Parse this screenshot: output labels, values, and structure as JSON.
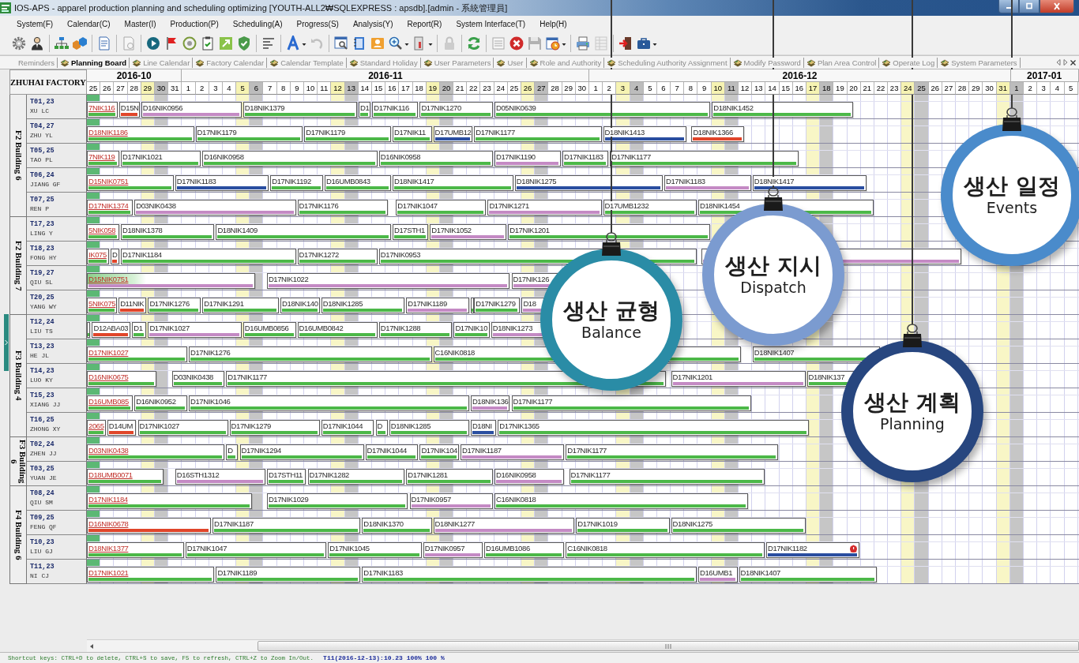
{
  "window": {
    "title": "IOS-APS - apparel production planning and scheduling optimizing [YOUTH-ALL2₩SQLEXPRESS : apsdb].[admin - 系統管理員]"
  },
  "menu": [
    "System(F)",
    "Calendar(C)",
    "Master(I)",
    "Production(P)",
    "Scheduling(A)",
    "Progress(S)",
    "Analysis(Y)",
    "Report(R)",
    "System Interface(T)",
    "Help(H)"
  ],
  "toolbar": [
    {
      "items": [
        {
          "disabled": false,
          "menu": false
        },
        {
          "disabled": false,
          "menu": false
        }
      ]
    },
    {
      "items": [
        {
          "disabled": false,
          "menu": false
        },
        {
          "disabled": false,
          "menu": false
        }
      ]
    },
    {
      "items": [
        {
          "disabled": false,
          "menu": false
        }
      ]
    },
    {
      "items": [
        {
          "disabled": true,
          "menu": false
        }
      ]
    },
    {
      "items": [
        {
          "disabled": false,
          "menu": false
        },
        {
          "disabled": false,
          "menu": false
        },
        {
          "disabled": false,
          "menu": false
        },
        {
          "disabled": false,
          "menu": false
        },
        {
          "disabled": false,
          "menu": false
        },
        {
          "disabled": false,
          "menu": false
        }
      ]
    },
    {
      "items": [
        {
          "disabled": false,
          "menu": false
        }
      ]
    },
    {
      "items": [
        {
          "disabled": false,
          "menu": true
        },
        {
          "disabled": true,
          "menu": false
        }
      ]
    },
    {
      "items": [
        {
          "disabled": false,
          "menu": false
        },
        {
          "disabled": false,
          "menu": false
        },
        {
          "disabled": false,
          "menu": false
        },
        {
          "disabled": false,
          "menu": true
        },
        {
          "disabled": false,
          "menu": true
        }
      ]
    },
    {
      "items": [
        {
          "disabled": true,
          "menu": false
        }
      ]
    },
    {
      "items": [
        {
          "disabled": false,
          "menu": false
        }
      ]
    },
    {
      "items": [
        {
          "disabled": true,
          "menu": false
        },
        {
          "disabled": false,
          "menu": false
        },
        {
          "disabled": true,
          "menu": false
        },
        {
          "disabled": false,
          "menu": true
        }
      ]
    },
    {
      "items": [
        {
          "disabled": false,
          "menu": false
        },
        {
          "disabled": true,
          "menu": false
        }
      ]
    },
    {
      "items": [
        {
          "disabled": false,
          "menu": false
        },
        {
          "disabled": false,
          "menu": true
        }
      ]
    }
  ],
  "tabs": [
    {
      "label": "Reminders",
      "selected": false,
      "kind": "plain"
    },
    {
      "label": "Planning Board",
      "selected": true,
      "kind": "module"
    },
    {
      "label": "Line Calendar",
      "selected": false,
      "kind": "module"
    },
    {
      "label": "Factory Calendar",
      "selected": false,
      "kind": "module"
    },
    {
      "label": "Calendar Template",
      "selected": false,
      "kind": "module"
    },
    {
      "label": "Standard Holiday",
      "selected": false,
      "kind": "module"
    },
    {
      "label": "User Parameters",
      "selected": false,
      "kind": "module"
    },
    {
      "label": "User",
      "selected": false,
      "kind": "module"
    },
    {
      "label": "Role and Authority",
      "selected": false,
      "kind": "module"
    },
    {
      "label": "Scheduling Authority Assignment",
      "selected": false,
      "kind": "module"
    },
    {
      "label": "Modify Password",
      "selected": false,
      "kind": "module"
    },
    {
      "label": "Plan Area Control",
      "selected": false,
      "kind": "module"
    },
    {
      "label": "Operate Log",
      "selected": false,
      "kind": "module"
    },
    {
      "label": "System Parameters",
      "selected": false,
      "kind": "module"
    }
  ],
  "board": {
    "corner": "ZHUHAI FACTORY",
    "months": [
      {
        "label": "2016-10",
        "days": [
          {
            "label": "25",
            "kind": "workday"
          },
          {
            "label": "26",
            "kind": "workday"
          },
          {
            "label": "27",
            "kind": "workday"
          },
          {
            "label": "28",
            "kind": "workday"
          },
          {
            "label": "29",
            "kind": "saturday"
          },
          {
            "label": "30",
            "kind": "sunday"
          },
          {
            "label": "31",
            "kind": "workday"
          }
        ]
      },
      {
        "label": "2016-11",
        "days": [
          {
            "label": "1",
            "kind": "workday"
          },
          {
            "label": "2",
            "kind": "workday"
          },
          {
            "label": "3",
            "kind": "workday"
          },
          {
            "label": "4",
            "kind": "workday"
          },
          {
            "label": "5",
            "kind": "saturday"
          },
          {
            "label": "6",
            "kind": "sunday"
          },
          {
            "label": "7",
            "kind": "workday"
          },
          {
            "label": "8",
            "kind": "workday"
          },
          {
            "label": "9",
            "kind": "workday"
          },
          {
            "label": "10",
            "kind": "workday"
          },
          {
            "label": "11",
            "kind": "workday"
          },
          {
            "label": "12",
            "kind": "saturday"
          },
          {
            "label": "13",
            "kind": "sunday"
          },
          {
            "label": "14",
            "kind": "workday"
          },
          {
            "label": "15",
            "kind": "workday"
          },
          {
            "label": "16",
            "kind": "workday"
          },
          {
            "label": "17",
            "kind": "workday"
          },
          {
            "label": "18",
            "kind": "workday"
          },
          {
            "label": "19",
            "kind": "saturday"
          },
          {
            "label": "20",
            "kind": "sunday"
          },
          {
            "label": "21",
            "kind": "workday"
          },
          {
            "label": "22",
            "kind": "workday"
          },
          {
            "label": "23",
            "kind": "workday"
          },
          {
            "label": "24",
            "kind": "workday"
          },
          {
            "label": "25",
            "kind": "workday"
          },
          {
            "label": "26",
            "kind": "saturday"
          },
          {
            "label": "27",
            "kind": "sunday"
          },
          {
            "label": "28",
            "kind": "workday"
          },
          {
            "label": "29",
            "kind": "workday"
          },
          {
            "label": "30",
            "kind": "workday"
          }
        ]
      },
      {
        "label": "2016-12",
        "days": [
          {
            "label": "1",
            "kind": "workday"
          },
          {
            "label": "2",
            "kind": "workday"
          },
          {
            "label": "3",
            "kind": "saturday"
          },
          {
            "label": "4",
            "kind": "sunday"
          },
          {
            "label": "5",
            "kind": "workday"
          },
          {
            "label": "6",
            "kind": "workday"
          },
          {
            "label": "7",
            "kind": "workday"
          },
          {
            "label": "8",
            "kind": "workday"
          },
          {
            "label": "9",
            "kind": "workday"
          },
          {
            "label": "10",
            "kind": "saturday"
          },
          {
            "label": "11",
            "kind": "sunday"
          },
          {
            "label": "12",
            "kind": "workday"
          },
          {
            "label": "13",
            "kind": "workday"
          },
          {
            "label": "14",
            "kind": "workday"
          },
          {
            "label": "15",
            "kind": "workday"
          },
          {
            "label": "16",
            "kind": "workday"
          },
          {
            "label": "17",
            "kind": "saturday"
          },
          {
            "label": "18",
            "kind": "sunday"
          },
          {
            "label": "19",
            "kind": "workday"
          },
          {
            "label": "20",
            "kind": "workday"
          },
          {
            "label": "21",
            "kind": "workday"
          },
          {
            "label": "22",
            "kind": "workday"
          },
          {
            "label": "23",
            "kind": "workday"
          },
          {
            "label": "24",
            "kind": "saturday"
          },
          {
            "label": "25",
            "kind": "sunday"
          },
          {
            "label": "26",
            "kind": "workday"
          },
          {
            "label": "27",
            "kind": "workday"
          },
          {
            "label": "28",
            "kind": "workday"
          },
          {
            "label": "29",
            "kind": "workday"
          },
          {
            "label": "30",
            "kind": "workday"
          },
          {
            "label": "31",
            "kind": "saturday"
          }
        ]
      },
      {
        "label": "2017-01",
        "days": [
          {
            "label": "1",
            "kind": "sunday"
          },
          {
            "label": "2",
            "kind": "workday"
          },
          {
            "label": "3",
            "kind": "workday"
          },
          {
            "label": "4",
            "kind": "workday"
          },
          {
            "label": "5",
            "kind": "workday"
          }
        ]
      }
    ],
    "groups": [
      {
        "label": "F2 Building 6",
        "resources": [
          {
            "code": "T01,23",
            "name": "XU LC",
            "running": true,
            "tasks": [
              {
                "label": "7NIK116",
                "color": "#4cb848",
                "kind": "started"
              },
              {
                "label": "D15N",
                "color": "#e0452a",
                "kind": "planned"
              },
              {
                "label": "D16NIK0956",
                "color": "#c48ac4",
                "kind": "planned"
              },
              {
                "label": "D18NIK1379",
                "color": "#4cb848",
                "kind": "planned"
              },
              {
                "label": "D1",
                "color": "#4cb848",
                "kind": "planned"
              },
              {
                "label": "D17NIK116",
                "color": "#4cb848",
                "kind": "planned"
              },
              {
                "label": "D17NIK1270",
                "color": "#4cb848",
                "kind": "planned"
              },
              {
                "label": "D05NIK0639",
                "color": "#4cb848",
                "kind": "planned"
              },
              {
                "label": "D18NIK1452",
                "color": "#4cb848",
                "kind": "planned"
              }
            ]
          },
          {
            "code": "T04,27",
            "name": "ZHU YL",
            "running": true,
            "tasks": [
              {
                "label": "D18NIK1186",
                "color": "#4cb848",
                "kind": "started"
              },
              {
                "label": "D17NIK1179",
                "color": "#4cb848",
                "kind": "planned"
              },
              {
                "label": "D17NIK1179",
                "color": "#4cb848",
                "kind": "planned"
              },
              {
                "label": "D17NIK11",
                "color": "#4cb848",
                "kind": "planned"
              },
              {
                "label": "D17UMB12",
                "color": "#2a4ea0",
                "kind": "planned"
              },
              {
                "label": "D17NIK1177",
                "color": "#4cb848",
                "kind": "planned"
              },
              {
                "label": "D18NIK1413",
                "color": "#2a4ea0",
                "kind": "planned"
              },
              {
                "label": "D18NIK1366",
                "color": "#e0452a",
                "kind": "planned"
              }
            ]
          },
          {
            "code": "T05,25",
            "name": "TAO PL",
            "running": true,
            "tasks": [
              {
                "label": "7NIK119",
                "color": "#4cb848",
                "kind": "started"
              },
              {
                "label": "D17NIK1021",
                "color": "#4cb848",
                "kind": "planned"
              },
              {
                "label": "D16NIK0958",
                "color": "#4cb848",
                "kind": "planned"
              },
              {
                "label": "D16NIK0958",
                "color": "#4cb848",
                "kind": "planned"
              },
              {
                "label": "D17NIK1190",
                "color": "#c48ac4",
                "kind": "planned"
              },
              {
                "label": "D17NIK1183",
                "color": "#4cb848",
                "kind": "planned"
              },
              {
                "label": "D17NIK1177",
                "color": "#4cb848",
                "kind": "planned"
              }
            ]
          },
          {
            "code": "T06,24",
            "name": "JIANG GF",
            "running": true,
            "tasks": [
              {
                "label": "D15NIK0751",
                "color": "#4cb848",
                "kind": "started"
              },
              {
                "label": "D17NIK1183",
                "color": "#2a4ea0",
                "kind": "planned"
              },
              {
                "label": "D17NIK1192",
                "color": "#4cb848",
                "kind": "planned"
              },
              {
                "label": "D16UMB0843",
                "color": "#4cb848",
                "kind": "planned"
              },
              {
                "label": "D18NIK1417",
                "color": "#4cb848",
                "kind": "planned"
              },
              {
                "label": "D18NIK1275",
                "color": "#2a4ea0",
                "kind": "planned"
              },
              {
                "label": "D17NIK1183",
                "color": "#c48ac4",
                "kind": "planned"
              },
              {
                "label": "D18NIK1417",
                "color": "#2a4ea0",
                "kind": "planned"
              }
            ]
          },
          {
            "code": "T07,25",
            "name": "REN P",
            "running": true,
            "tasks": [
              {
                "label": "D17NIK1374",
                "color": "#4cb848",
                "kind": "started"
              },
              {
                "label": "D03NIK0438",
                "color": "#c48ac4",
                "kind": "planned"
              },
              {
                "label": "D17NIK1176",
                "color": "#4cb848",
                "kind": "planned"
              },
              {
                "label": "D17NIK1047",
                "color": "#4cb848",
                "kind": "planned"
              },
              {
                "label": "D17NIK1271",
                "color": "#c48ac4",
                "kind": "planned"
              },
              {
                "label": "D17UMB1232",
                "color": "#4cb848",
                "kind": "planned"
              },
              {
                "label": "D18NIK1454",
                "color": "#4cb848",
                "kind": "planned"
              }
            ]
          }
        ]
      },
      {
        "label": "F2 Building 7",
        "resources": [
          {
            "code": "T17,23",
            "name": "LING Y",
            "running": true,
            "tasks": [
              {
                "label": "5NIK058",
                "color": "#4cb848",
                "kind": "started"
              },
              {
                "label": "D18NIK1378",
                "color": "#4cb848",
                "kind": "planned"
              },
              {
                "label": "D18NIK1409",
                "color": "#4cb848",
                "kind": "planned"
              },
              {
                "label": "D17STH1",
                "color": "#4cb848",
                "kind": "planned"
              },
              {
                "label": "D17NIK1052",
                "color": "#c48ac4",
                "kind": "planned"
              },
              {
                "label": "D17NIK1201",
                "color": "#4cb848",
                "kind": "planned"
              }
            ]
          },
          {
            "code": "T18,23",
            "name": "FONG HY",
            "running": true,
            "tasks": [
              {
                "label": "IK075",
                "color": "#4cb848",
                "kind": "started"
              },
              {
                "label": "D",
                "color": "#e0452a",
                "kind": "planned"
              },
              {
                "label": "D17NIK1184",
                "color": "#4cb848",
                "kind": "planned"
              },
              {
                "label": "D17NIK1272",
                "color": "#4cb848",
                "kind": "planned"
              },
              {
                "label": "D17NIK0953",
                "color": "#4cb848",
                "kind": "planned"
              },
              {
                "color": "#c48ac4",
                "kind": "planned"
              }
            ]
          },
          {
            "code": "T19,27",
            "name": "QIU SL",
            "running": true,
            "tasks": [
              {
                "label": "D15NIK0751",
                "color": "#c48ac4",
                "kind": "started",
                "level": 0.35
              },
              {
                "label": "D17NIK1022",
                "color": "#c48ac4",
                "kind": "planned"
              },
              {
                "label": "D17NIK126",
                "color": "#c48ac4",
                "kind": "planned"
              }
            ]
          },
          {
            "code": "T20,25",
            "name": "YANG WY",
            "running": true,
            "tasks": [
              {
                "label": "5NIK075",
                "color": "#4cb848",
                "kind": "started"
              },
              {
                "label": "D11NIK",
                "color": "#e0452a",
                "kind": "planned"
              },
              {
                "label": "D17NIK1276",
                "color": "#4cb848",
                "kind": "planned"
              },
              {
                "label": "D17NIK1291",
                "color": "#4cb848",
                "kind": "planned"
              },
              {
                "label": "D18NIK140",
                "color": "#4cb848",
                "kind": "planned"
              },
              {
                "label": "D18NIK1285",
                "color": "#4cb848",
                "kind": "planned"
              },
              {
                "label": "D17NIK1189",
                "color": "#c48ac4",
                "kind": "planned"
              },
              {
                "color": "#4cb848",
                "kind": "planned"
              },
              {
                "label": "D17NIK1279",
                "color": "#4cb848",
                "kind": "planned"
              },
              {
                "label": "D18",
                "color": "#c48ac4",
                "kind": "planned"
              }
            ]
          }
        ]
      },
      {
        "label": "F3 Building 4",
        "resources": [
          {
            "code": "T12,24",
            "name": "LIU TS",
            "running": true,
            "tasks": [
              {
                "color": "#4cb848",
                "kind": "started"
              },
              {
                "label": "D12ABA03",
                "color": "#e0452a",
                "kind": "planned"
              },
              {
                "label": "D1",
                "color": "#4cb848",
                "kind": "planned"
              },
              {
                "label": "D17NIK1027",
                "color": "#c48ac4",
                "kind": "planned"
              },
              {
                "label": "D16UMB0856",
                "color": "#4cb848",
                "kind": "planned"
              },
              {
                "label": "D16UMB0842",
                "color": "#4cb848",
                "kind": "planned"
              },
              {
                "label": "D17NIK1288",
                "color": "#4cb848",
                "kind": "planned"
              },
              {
                "label": "D17NIK10",
                "color": "#4cb848",
                "kind": "planned"
              },
              {
                "label": "D18NIK1273",
                "color": "#c48ac4",
                "kind": "planned"
              }
            ]
          },
          {
            "code": "T13,23",
            "name": "HE JL",
            "running": true,
            "tasks": [
              {
                "label": "D17NIK1027",
                "color": "#4cb848",
                "kind": "started"
              },
              {
                "label": "D17NIK1276",
                "color": "#4cb848",
                "kind": "planned"
              },
              {
                "label": "C16NIK0818",
                "color": "#4cb848",
                "kind": "planned"
              },
              {
                "label": "D18NIK1407",
                "color": "#4cb848",
                "kind": "planned"
              }
            ]
          },
          {
            "code": "T14,23",
            "name": "LUO KY",
            "running": true,
            "tasks": [
              {
                "label": "D16NIK0675",
                "color": "#4cb848",
                "kind": "started"
              },
              {
                "label": "D03NIK0438",
                "color": "#4cb848",
                "kind": "planned"
              },
              {
                "label": "D17NIK1177",
                "color": "#4cb848",
                "kind": "planned"
              },
              {
                "label": "D17NIK1201",
                "color": "#c48ac4",
                "kind": "planned"
              },
              {
                "label": "D18NIK137",
                "color": "#4cb848",
                "kind": "planned"
              }
            ]
          },
          {
            "code": "T15,23",
            "name": "XIANG JJ",
            "running": true,
            "tasks": [
              {
                "label": "D16UMB085",
                "color": "#4cb848",
                "kind": "started"
              },
              {
                "label": "D16NIK0952",
                "color": "#4cb848",
                "kind": "planned"
              },
              {
                "label": "D17NIK1046",
                "color": "#4cb848",
                "kind": "planned"
              },
              {
                "label": "D18NIK136",
                "color": "#c48ac4",
                "kind": "planned"
              },
              {
                "label": "D17NIK1177",
                "color": "#4cb848",
                "kind": "planned"
              }
            ]
          },
          {
            "code": "T16,25",
            "name": "ZHONG XY",
            "running": true,
            "tasks": [
              {
                "label": "2065",
                "color": "#4cb848",
                "kind": "started"
              },
              {
                "label": "D14UM",
                "color": "#e0452a",
                "kind": "planned"
              },
              {
                "label": "D17NIK1027",
                "color": "#4cb848",
                "kind": "planned"
              },
              {
                "label": "D17NIK1279",
                "color": "#4cb848",
                "kind": "planned"
              },
              {
                "label": "D17NIK1044",
                "color": "#4cb848",
                "kind": "planned"
              },
              {
                "label": "D",
                "color": "#4cb848",
                "kind": "planned"
              },
              {
                "label": "D18NIK1285",
                "color": "#4cb848",
                "kind": "planned"
              },
              {
                "label": "D18NI",
                "color": "#2a4ea0",
                "kind": "planned"
              },
              {
                "label": "D17NIK1365",
                "color": "#4cb848",
                "kind": "planned"
              }
            ]
          }
        ]
      },
      {
        "label": "F3 Building 6",
        "resources": [
          {
            "code": "T02,24",
            "name": "ZHEN JJ",
            "running": true,
            "tasks": [
              {
                "label": "D03NIK0438",
                "color": "#4cb848",
                "kind": "started"
              },
              {
                "label": "D",
                "color": "#4cb848",
                "kind": "planned"
              },
              {
                "label": "D17NIK1294",
                "color": "#4cb848",
                "kind": "planned"
              },
              {
                "label": "D17NIK1044",
                "color": "#4cb848",
                "kind": "planned"
              },
              {
                "label": "D17NIK104",
                "color": "#4cb848",
                "kind": "planned"
              },
              {
                "label": "D17NIK1187",
                "color": "#c48ac4",
                "kind": "planned"
              },
              {
                "label": "D17NIK1177",
                "color": "#4cb848",
                "kind": "planned"
              }
            ]
          },
          {
            "code": "T03,25",
            "name": "YUAN JE",
            "running": true,
            "tasks": [
              {
                "label": "D18UMB0071",
                "color": "#4cb848",
                "kind": "started"
              },
              {
                "label": "D16STH1312",
                "color": "#c48ac4",
                "kind": "planned"
              },
              {
                "label": "D17STH11",
                "color": "#4cb848",
                "kind": "planned"
              },
              {
                "label": "D17NIK1282",
                "color": "#4cb848",
                "kind": "planned"
              },
              {
                "label": "D17NIK1281",
                "color": "#4cb848",
                "kind": "planned"
              },
              {
                "label": "D16NIK0958",
                "color": "#c48ac4",
                "kind": "planned"
              },
              {
                "label": "D17NIK1177",
                "color": "#4cb848",
                "kind": "planned"
              }
            ]
          }
        ]
      },
      {
        "label": "F4 Building 6",
        "resources": [
          {
            "code": "T08,24",
            "name": "QIU SM",
            "running": true,
            "tasks": [
              {
                "label": "D17NIK1184",
                "color": "#4cb848",
                "kind": "started"
              },
              {
                "label": "D17NIK1029",
                "color": "#4cb848",
                "kind": "planned"
              },
              {
                "label": "D17NIK0957",
                "color": "#c48ac4",
                "kind": "planned"
              },
              {
                "label": "C16NIK0818",
                "color": "#4cb848",
                "kind": "planned"
              }
            ]
          },
          {
            "code": "T09,25",
            "name": "FENG QF",
            "running": true,
            "tasks": [
              {
                "label": "D16NIK0678",
                "color": "#e0452a",
                "kind": "started"
              },
              {
                "label": "D17NIK1187",
                "color": "#4cb848",
                "kind": "planned"
              },
              {
                "label": "D18NIK1370",
                "color": "#4cb848",
                "kind": "planned"
              },
              {
                "label": "D18NIK1277",
                "color": "#c48ac4",
                "kind": "planned"
              },
              {
                "label": "D17NIK1019",
                "color": "#4cb848",
                "kind": "planned"
              },
              {
                "label": "D18NIK1275",
                "color": "#4cb848",
                "kind": "planned"
              }
            ]
          },
          {
            "code": "T10,23",
            "name": "LIU GJ",
            "running": true,
            "tasks": [
              {
                "label": "D18NIK1377",
                "color": "#4cb848",
                "kind": "started"
              },
              {
                "label": "D17NIK1047",
                "color": "#4cb848",
                "kind": "planned"
              },
              {
                "label": "D17NIK1045",
                "color": "#4cb848",
                "kind": "planned"
              },
              {
                "label": "D17NIK0957",
                "color": "#c48ac4",
                "kind": "planned"
              },
              {
                "label": "D16UMB1086",
                "color": "#4cb848",
                "kind": "planned"
              },
              {
                "label": "C16NIK0818",
                "color": "#4cb848",
                "kind": "planned"
              },
              {
                "label": "D17NIK1182",
                "color": "#2a4ea0",
                "kind": "alert"
              }
            ]
          },
          {
            "code": "T11,23",
            "name": "NI CJ",
            "running": true,
            "tasks": [
              {
                "label": "D17NIK1021",
                "color": "#4cb848",
                "kind": "started"
              },
              {
                "label": "D17NIK1189",
                "color": "#4cb848",
                "kind": "planned"
              },
              {
                "label": "D17NIK1183",
                "color": "#4cb848",
                "kind": "planned"
              },
              {
                "label": "D16UMB1",
                "color": "#c48ac4",
                "kind": "planned"
              },
              {
                "label": "D18NIK1407",
                "color": "#4cb848",
                "kind": "planned"
              }
            ]
          }
        ]
      }
    ]
  },
  "bubbles": [
    {
      "title": "생산 일정",
      "subtitle": "Events",
      "color": "#4a8bcb"
    },
    {
      "title": "생산 지시",
      "subtitle": "Dispatch",
      "color": "#7b9bd0"
    },
    {
      "title": "생산 균형",
      "subtitle": "Balance",
      "color": "#2a8ca6"
    },
    {
      "title": "생산 계획",
      "subtitle": "Planning",
      "color": "#27467f"
    }
  ],
  "status_bar": {
    "hint": "Shortcut keys: CTRL+D to delete, CTRL+S to save, F5 to refresh, CTRL+Z to Zoom In/Out.",
    "selection": "T11(2016-12-13):10.23 100% 100 %"
  }
}
